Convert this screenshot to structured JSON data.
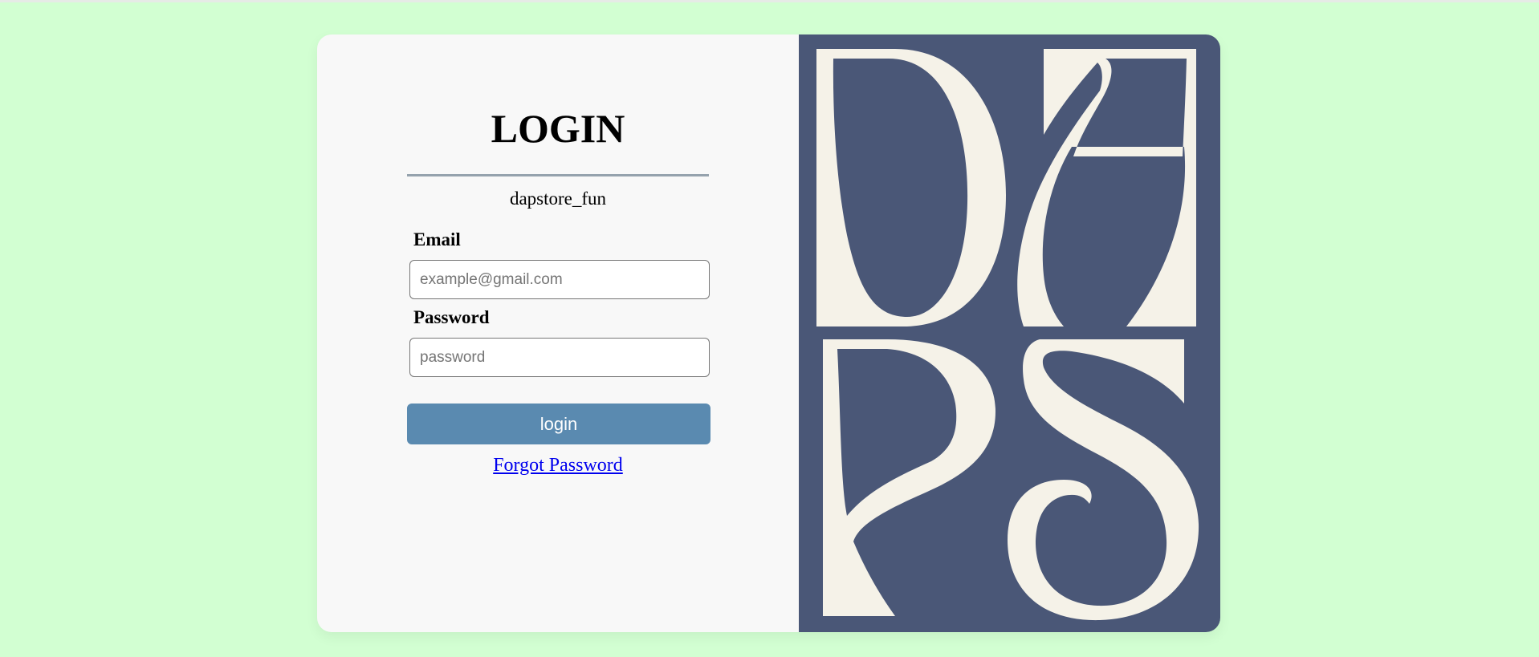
{
  "login_form": {
    "title": "LOGIN",
    "subtitle": "dapstore_fun",
    "email_label": "Email",
    "email_placeholder": "example@gmail.com",
    "email_value": "",
    "password_label": "Password",
    "password_placeholder": "password",
    "password_value": "",
    "login_button_label": "login",
    "forgot_password_label": "Forgot Password"
  },
  "logo": {
    "text": "DAPS",
    "icon": "daps-monogram-logo"
  },
  "colors": {
    "page_background": "#d2ffd2",
    "card_left": "#f8f8f8",
    "logo_panel": "#4a5777",
    "logo_letters": "#f5f2e8",
    "login_button": "#5a8ab0",
    "divider": "#95a2ad",
    "link": "#0000ee"
  }
}
